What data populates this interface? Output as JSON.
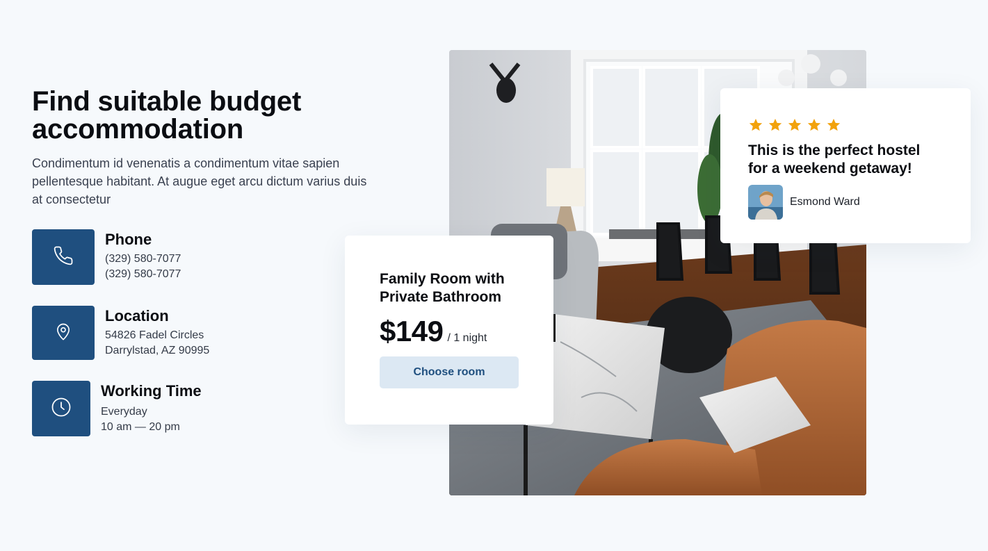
{
  "hero": {
    "title_line1": "Find suitable budget",
    "title_line2": "accommodation",
    "description": "Condimentum id venenatis a condimentum vitae sapien pellentesque habitant. At augue eget arcu dictum varius duis at consectetur"
  },
  "contacts": {
    "phone": {
      "heading": "Phone",
      "line1": "(329) 580-7077",
      "line2": "(329) 580-7077",
      "icon": "phone-icon"
    },
    "location": {
      "heading": "Location",
      "line1": "54826 Fadel Circles",
      "line2": "Darrylstad, AZ 90995",
      "icon": "location-pin-icon"
    },
    "working_time": {
      "heading": "Working Time",
      "line1": "Everyday",
      "line2": "10 am — 20 pm",
      "icon": "clock-icon"
    }
  },
  "room_card": {
    "name_line1": "Family Room with",
    "name_line2": "Private Bathroom",
    "price": "$149",
    "per": "/ 1 night",
    "button_label": "Choose room"
  },
  "review_card": {
    "rating": 5,
    "rating_max": 5,
    "quote_line1": "This is the perfect hostel",
    "quote_line2": "for a weekend getaway!",
    "reviewer_name": "Esmond Ward"
  },
  "colors": {
    "accent": "#1f4f7f",
    "star": "#f2a20c",
    "button_bg": "#dce8f3",
    "page_bg": "#f6f9fc"
  }
}
